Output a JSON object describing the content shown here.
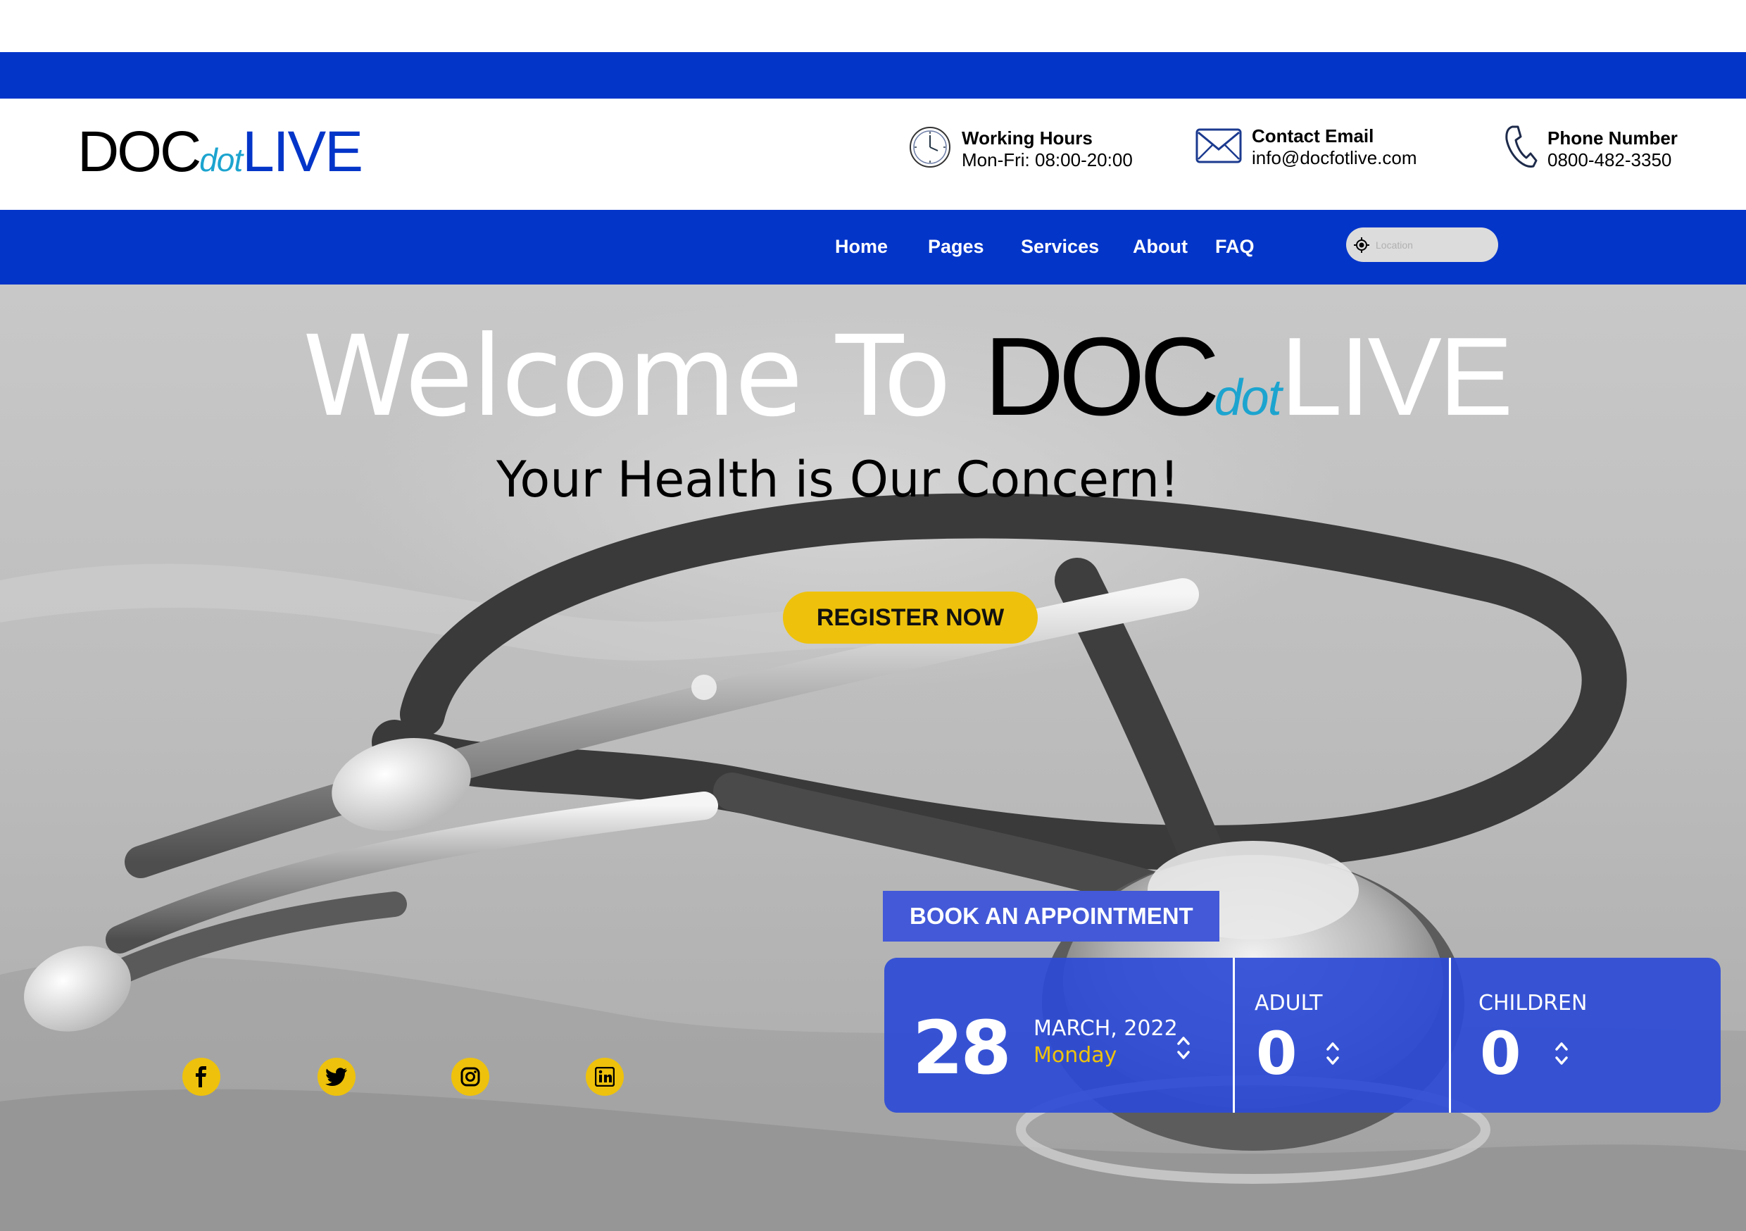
{
  "logo": {
    "doc": "DOC",
    "dot": "dot",
    "live": "LIVE"
  },
  "header": {
    "working_hours": {
      "title": "Working Hours",
      "value": "Mon-Fri: 08:00-20:00",
      "icon": "clock-icon"
    },
    "contact_email": {
      "title": "Contact Email",
      "value": "info@docfotlive.com",
      "icon": "envelope-icon"
    },
    "phone": {
      "title": "Phone Number",
      "value": "0800-482-3350",
      "icon": "phone-icon"
    }
  },
  "nav": {
    "items": [
      {
        "label": "Home"
      },
      {
        "label": "Pages"
      },
      {
        "label": "Services"
      },
      {
        "label": "About"
      },
      {
        "label": "FAQ"
      }
    ],
    "location_placeholder": "Location"
  },
  "hero": {
    "title_prefix": "Welcome To",
    "subtitle": "Your Health is Our Concern!",
    "register_label": "REGISTER NOW"
  },
  "social": [
    "facebook-icon",
    "twitter-icon",
    "instagram-icon",
    "linkedin-icon"
  ],
  "booking": {
    "tab_label": "BOOK AN APPOINTMENT",
    "day": "28",
    "month_year": "MARCH, 2022",
    "weekday": "Monday",
    "adult_label": "ADULT",
    "adult_count": "0",
    "children_label": "CHILDREN",
    "children_count": "0"
  },
  "colors": {
    "brand_blue": "#0335c9",
    "accent_yellow": "#eec20c",
    "logo_dot": "#1ca4cf",
    "panel_blue": "#2d4bd7"
  }
}
